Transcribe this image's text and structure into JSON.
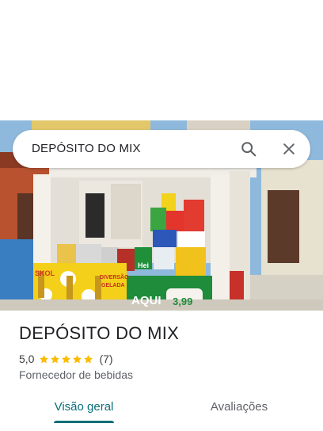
{
  "search": {
    "query": "DEPÓSITO DO MIX"
  },
  "photo": {
    "signs": {
      "banner": "SKOL",
      "aqui": "AQUI",
      "price": "3,99",
      "heineken": "Hei",
      "diversao": "DIVERSÃO",
      "gelada": "GELADA"
    }
  },
  "place": {
    "title": "DEPÓSITO DO MIX",
    "rating": "5,0",
    "stars": 5,
    "reviews": "(7)",
    "category": "Fornecedor de bebidas"
  },
  "tabs": [
    {
      "label": "Visão geral",
      "active": true
    },
    {
      "label": "Avaliações",
      "active": false
    }
  ],
  "colors": {
    "accent": "#0b6e77",
    "star": "#fbbc04"
  }
}
